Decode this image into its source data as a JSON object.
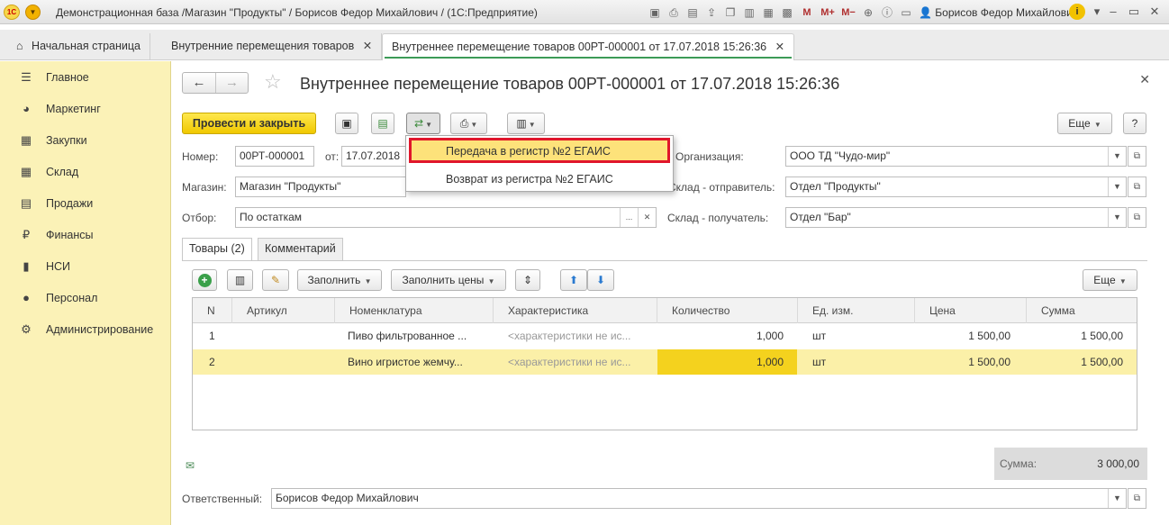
{
  "app": {
    "title": "Демонстрационная база /Магазин \"Продукты\" / Борисов Федор Михайлович /  (1С:Предприятие)",
    "user": "Борисов Федор Михайлович",
    "logo_text": "1С",
    "toolbar_icons": [
      "save-icon",
      "print-icon",
      "upload-icon",
      "copy-icon",
      "calc-icon",
      "calendar-icon"
    ],
    "memory": [
      "M",
      "M+",
      "M−"
    ]
  },
  "tabs": {
    "home": "Начальная страница",
    "list": "Внутренние перемещения товаров",
    "doc": "Внутреннее перемещение товаров 00РТ-000001 от 17.07.2018 15:26:36"
  },
  "sidebar": {
    "items": [
      {
        "label": "Главное",
        "icon": "menu-icon"
      },
      {
        "label": "Маркетинг",
        "icon": "pie-icon"
      },
      {
        "label": "Закупки",
        "icon": "cart-icon"
      },
      {
        "label": "Склад",
        "icon": "grid-icon"
      },
      {
        "label": "Продажи",
        "icon": "basket-icon"
      },
      {
        "label": "Финансы",
        "icon": "ruble-icon"
      },
      {
        "label": "НСИ",
        "icon": "book-icon"
      },
      {
        "label": "Персонал",
        "icon": "person-icon"
      },
      {
        "label": "Администрирование",
        "icon": "gear-icon"
      }
    ]
  },
  "doc": {
    "title": "Внутреннее перемещение товаров 00РТ-000001 от 17.07.2018 15:26:36",
    "post_close": "Провести и закрыть",
    "more": "Еще",
    "help": "?"
  },
  "form": {
    "number_label": "Номер:",
    "number": "00РТ-000001",
    "from_label": "от:",
    "date": "17.07.2018",
    "shop_label": "Магазин:",
    "shop": "Магазин \"Продукты\"",
    "filter_label": "Отбор:",
    "filter": "По остаткам",
    "org_label": "Организация:",
    "org": "ООО ТД \"Чудо-мир\"",
    "sender_label": "Склад - отправитель:",
    "sender": "Отдел \"Продукты\"",
    "receiver_label": "Склад - получатель:",
    "receiver": "Отдел \"Бар\"",
    "responsible_label": "Ответственный:",
    "responsible": "Борисов Федор Михайлович"
  },
  "popup": {
    "items": [
      "Передача в регистр №2 ЕГАИС",
      "Возврат из регистра №2 ЕГАИС"
    ]
  },
  "inner_tabs": {
    "goods": "Товары (2)",
    "comment": "Комментарий"
  },
  "table_toolbar": {
    "fill": "Заполнить",
    "fill_prices": "Заполнить цены",
    "more": "Еще"
  },
  "table": {
    "columns": [
      "N",
      "Артикул",
      "Номенклатура",
      "Характеристика",
      "Количество",
      "Ед. изм.",
      "Цена",
      "Сумма"
    ],
    "rows": [
      {
        "n": "1",
        "article": "",
        "item": "Пиво фильтрованное ...",
        "char": "<характеристики не ис...",
        "qty": "1,000",
        "unit": "шт",
        "price": "1 500,00",
        "sum": "1 500,00"
      },
      {
        "n": "2",
        "article": "",
        "item": "Вино игристое жемчу...",
        "char": "<характеристики не ис...",
        "qty": "1,000",
        "unit": "шт",
        "price": "1 500,00",
        "sum": "1 500,00"
      }
    ]
  },
  "total": {
    "label": "Сумма:",
    "value": "3 000,00"
  }
}
